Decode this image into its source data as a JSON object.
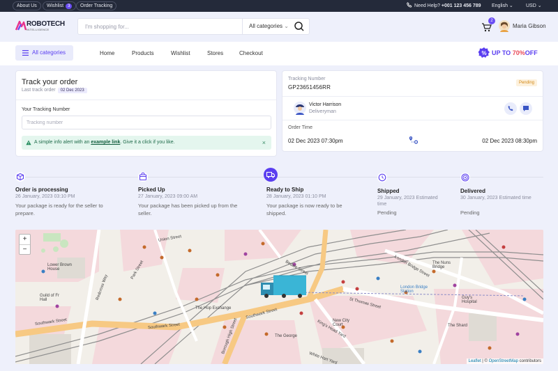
{
  "topbar": {
    "about": "About Us",
    "wishlist": "Wishlist",
    "wishlist_count": "3",
    "order_tracking": "Order Tracking",
    "help_label": "Need Help?",
    "phone": "+001 123 456 789",
    "language": "English",
    "currency": "USD"
  },
  "header": {
    "logo_main": "ROBOTECH",
    "logo_sub": "INTELLIGENCE",
    "search_placeholder": "I'm shopping for...",
    "category": "All categories",
    "cart_count": "2",
    "user_name": "Maria Gibson"
  },
  "nav": {
    "all_categories": "All categories",
    "links": [
      "Home",
      "Products",
      "Wishlist",
      "Stores",
      "Checkout"
    ],
    "promo_prefix": "UP TO",
    "promo_value": "70%",
    "promo_suffix": "OFF"
  },
  "track": {
    "title": "Track your order",
    "last_track_label": "Last track order",
    "last_track_date": "02 Dec 2023",
    "field_label": "Your Tracking Number",
    "field_placeholder": "Tracking number",
    "alert_prefix": "A simple info alert with an",
    "alert_link": "example link",
    "alert_suffix": ". Give it a click if you like.",
    "alert_close": "×"
  },
  "info": {
    "tracking_label": "Tracking Number",
    "tracking_number": "GP23651456RR",
    "status": "Pending",
    "driver_name": "Victor Harrison",
    "driver_role": "Deliveryman",
    "order_time_label": "Order Time",
    "from_time": "02 Dec 2023  07:30pm",
    "to_time": "02 Dec 2023  08:30pm"
  },
  "steps": [
    {
      "title": "Order is processing",
      "date": "26 January, 2023 03:10 PM",
      "desc": "Your package is ready for the seller to prepare."
    },
    {
      "title": "Picked Up",
      "date": "27 January, 2023 09:00 AM",
      "desc": "Your package has been picked up from the seller."
    },
    {
      "title": "Ready to Ship",
      "date": "28 January, 2023 01:10 PM",
      "desc": "Your package is now ready to be shipped."
    },
    {
      "title": "Shipped",
      "date": "29 January, 2023 Estimated time",
      "desc": "Pending"
    },
    {
      "title": "Delivered",
      "date": "30 January, 2023 Estimated time",
      "desc": "Pending"
    }
  ],
  "map": {
    "zoom_in": "+",
    "zoom_out": "−",
    "attribution_prefix": "Leaflet",
    "attribution_sep": " | © ",
    "attribution_link": "OpenStreetMap",
    "attribution_suffix": " contributors",
    "labels": {
      "southwark_street": "Southwark Street",
      "southwark_street_2": "Southwark Street",
      "southwark_street_3": "Southwark Street",
      "london_bridge_street": "London Bridge Street",
      "st_thomas_street": "St Thomas Street",
      "borough_high_street": "Borough High Street",
      "kings_head_yard": "King's Head Yard",
      "park_street": "Park Street",
      "bedale_street": "Bedale Street",
      "the_hop_exchange": "The Hop Exchange",
      "the_george": "The George",
      "the_shard": "The Shard",
      "white_hart_yard": "White Hart Yard",
      "lower_brown_house": "Lower Brown House",
      "union_street": "Union Street",
      "guild_hall": "Guild of Fr Hall",
      "redcross_way": "Redcross Way",
      "the_nuns_bridge": "The Nuns Bridge",
      "london_bridge": "London Bridge Station",
      "guys_hospital": "Guy's Hospital",
      "new_city_court": "New City Court"
    }
  }
}
